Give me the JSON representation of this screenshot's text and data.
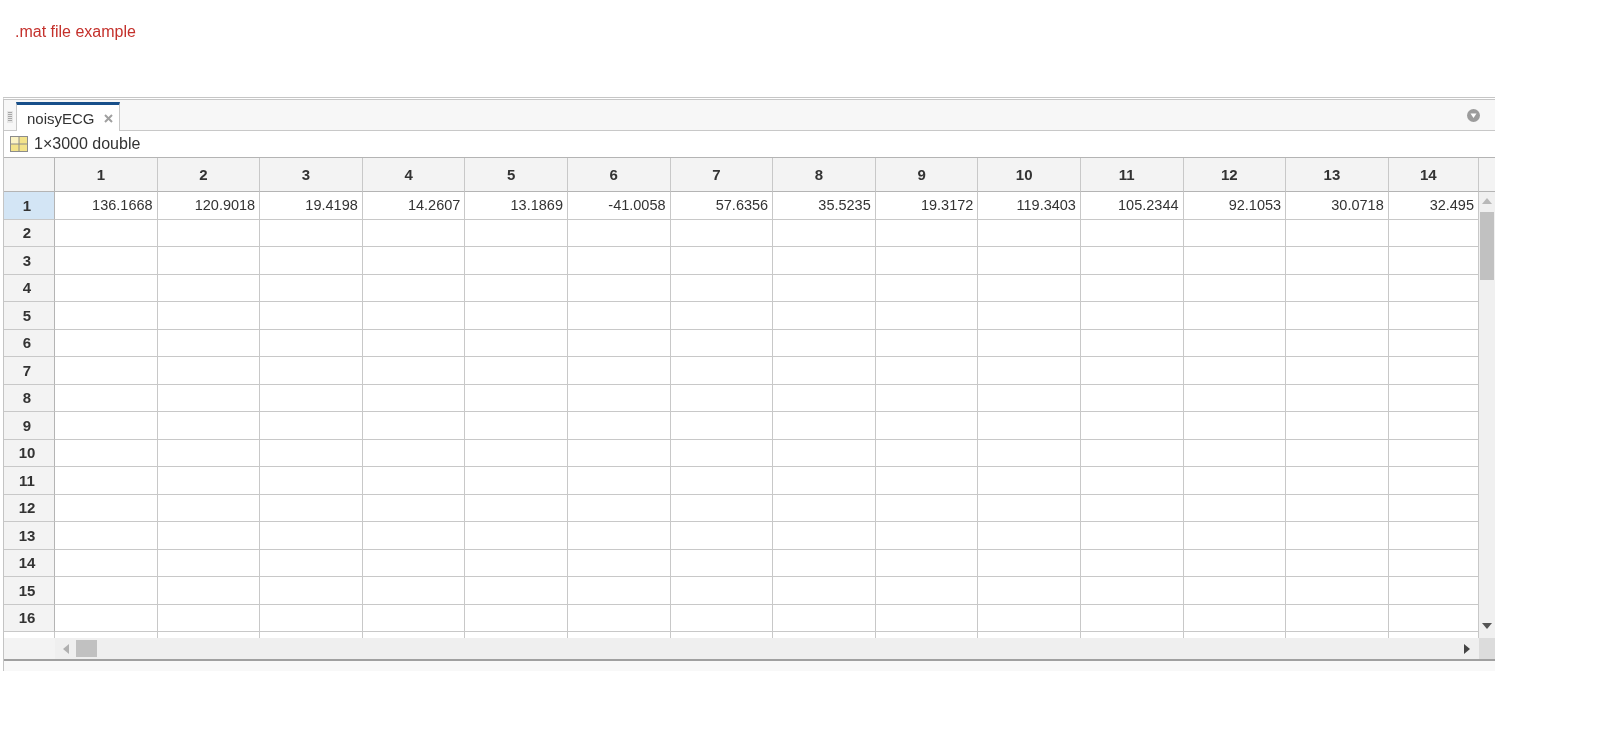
{
  "caption": ".mat file example",
  "panel": {
    "tabs": [
      {
        "label": "noisyECG",
        "selected": true
      }
    ],
    "variable_info": "1×3000 double",
    "table": {
      "columns": [
        "1",
        "2",
        "3",
        "4",
        "5",
        "6",
        "7",
        "8",
        "9",
        "10",
        "11",
        "12",
        "13",
        "14"
      ],
      "rows": [
        {
          "label": "1",
          "selected": true,
          "cells": [
            "136.1668",
            "120.9018",
            "19.4198",
            "14.2607",
            "13.1869",
            "-41.0058",
            "57.6356",
            "35.5235",
            "19.3172",
            "119.3403",
            "105.2344",
            "92.1053",
            "30.0718",
            "32.495"
          ]
        },
        {
          "label": "2",
          "selected": false
        },
        {
          "label": "3",
          "selected": false
        },
        {
          "label": "4",
          "selected": false
        },
        {
          "label": "5",
          "selected": false
        },
        {
          "label": "6",
          "selected": false
        },
        {
          "label": "7",
          "selected": false
        },
        {
          "label": "8",
          "selected": false
        },
        {
          "label": "9",
          "selected": false
        },
        {
          "label": "10",
          "selected": false
        },
        {
          "label": "11",
          "selected": false
        },
        {
          "label": "12",
          "selected": false
        },
        {
          "label": "13",
          "selected": false
        },
        {
          "label": "14",
          "selected": false
        },
        {
          "label": "15",
          "selected": false
        },
        {
          "label": "16",
          "selected": false
        }
      ]
    }
  }
}
